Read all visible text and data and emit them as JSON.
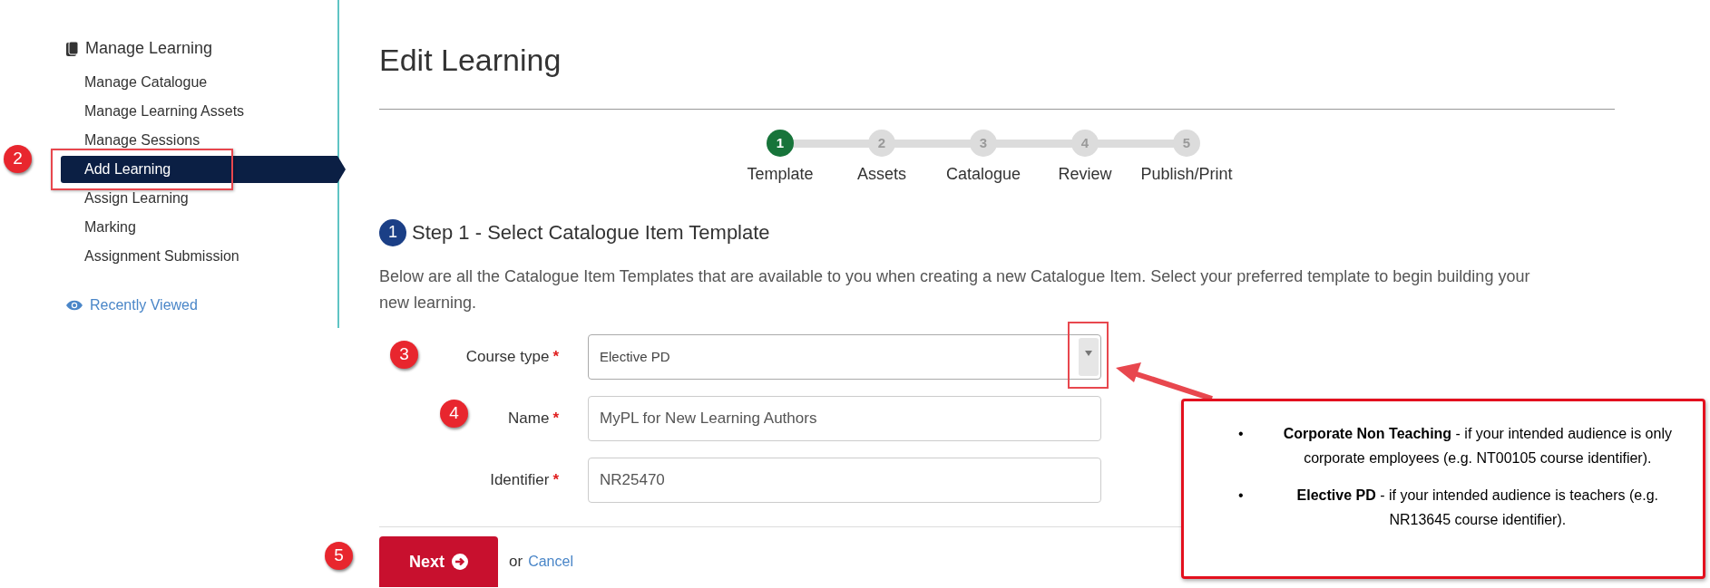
{
  "sidebar": {
    "heading": "Manage Learning",
    "items": [
      {
        "label": "Manage Catalogue",
        "selected": false
      },
      {
        "label": "Manage Learning Assets",
        "selected": false
      },
      {
        "label": "Manage Sessions",
        "selected": false
      },
      {
        "label": "Add Learning",
        "selected": true
      },
      {
        "label": "Assign Learning",
        "selected": false
      },
      {
        "label": "Marking",
        "selected": false
      },
      {
        "label": "Assignment Submission",
        "selected": false
      }
    ],
    "recent_link": "Recently Viewed"
  },
  "page_title": "Edit Learning",
  "stepper": [
    {
      "number": "1",
      "label": "Template",
      "selected": true
    },
    {
      "number": "2",
      "label": "Assets",
      "selected": false
    },
    {
      "number": "3",
      "label": "Catalogue",
      "selected": false
    },
    {
      "number": "4",
      "label": "Review",
      "selected": false
    },
    {
      "number": "5",
      "label": "Publish/Print",
      "selected": false
    }
  ],
  "step_heading": {
    "number": "1",
    "title": "Step 1 - Select Catalogue Item Template"
  },
  "intro": "Below are all the Catalogue Item Templates that are available to you when creating a new Catalogue Item. Select your preferred template to begin building your new learning.",
  "fields": [
    {
      "kind": "select",
      "label": "Course type",
      "required_mark": "*",
      "value": "Elective PD"
    },
    {
      "kind": "input",
      "label": "Name",
      "required_mark": "*",
      "value": "MyPL for New Learning Authors"
    },
    {
      "kind": "input",
      "label": "Identifier",
      "required_mark": "*",
      "value": "NR25470"
    }
  ],
  "actions": {
    "next": "Next",
    "or": "or",
    "cancel": "Cancel"
  },
  "annotations": {
    "badges": [
      "2",
      "3",
      "4",
      "5"
    ],
    "callout": [
      {
        "bullet": "•",
        "text": "**Corporate Non Teaching** -  if your intended audience is only corporate employees (e.g. NT00105 course identifier)."
      },
      {
        "bullet": "•",
        "text": "**Elective PD** - if your intended audience is teachers (e.g. NR13645 course identifier)."
      }
    ]
  }
}
